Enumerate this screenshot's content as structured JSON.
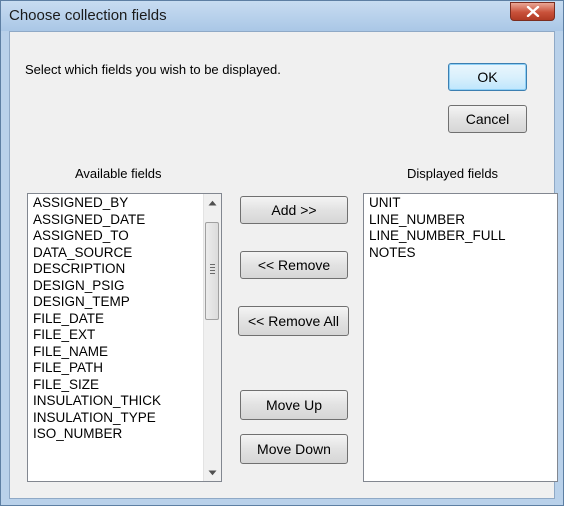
{
  "window": {
    "title": "Choose collection fields"
  },
  "prompt": "Select which fields you wish to be displayed.",
  "buttons": {
    "ok": "OK",
    "cancel": "Cancel",
    "add": "Add >>",
    "remove": "<< Remove",
    "remove_all": "<< Remove All",
    "move_up": "Move Up",
    "move_down": "Move Down"
  },
  "available": {
    "label": "Available fields",
    "items": [
      "ASSIGNED_BY",
      "ASSIGNED_DATE",
      "ASSIGNED_TO",
      "DATA_SOURCE",
      "DESCRIPTION",
      "DESIGN_PSIG",
      "DESIGN_TEMP",
      "FILE_DATE",
      "FILE_EXT",
      "FILE_NAME",
      "FILE_PATH",
      "FILE_SIZE",
      "INSULATION_THICK",
      "INSULATION_TYPE",
      "ISO_NUMBER"
    ]
  },
  "displayed": {
    "label": "Displayed fields",
    "items": [
      "UNIT",
      "LINE_NUMBER",
      "LINE_NUMBER_FULL",
      "NOTES"
    ]
  },
  "icons": {
    "close": "close-icon",
    "scroll_up": "chevron-up-icon",
    "scroll_down": "chevron-down-icon"
  }
}
